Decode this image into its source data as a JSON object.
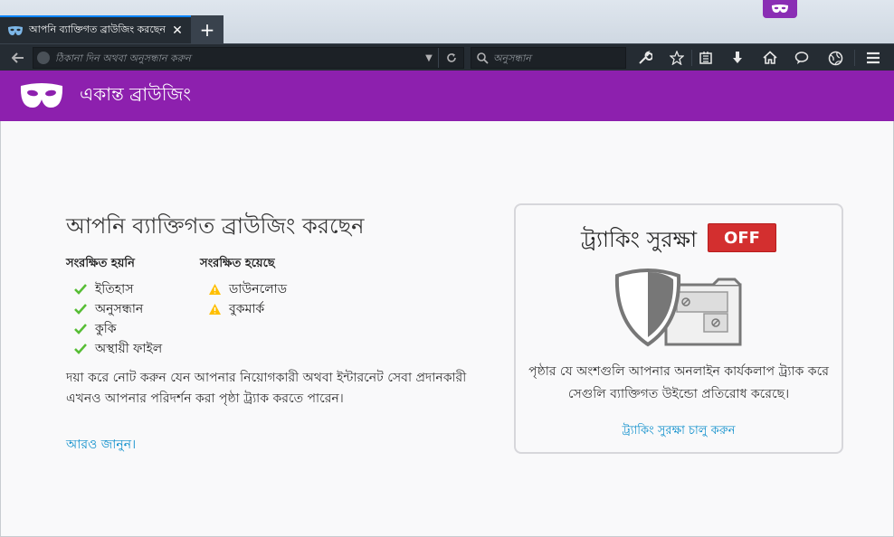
{
  "window": {
    "tab_title": "আপনি ব্যাক্তিগত ব্রাউজিং করছেন",
    "new_tab_label": "+"
  },
  "navbar": {
    "url_placeholder": "ঠিকানা দিন অথবা অনুসন্ধান করুন",
    "search_placeholder": "অনুসন্ধান"
  },
  "header": {
    "title": "একান্ত ব্রাউজিং"
  },
  "main": {
    "title": "আপনি ব্যাক্তিগত ব্রাউজিং করছেন",
    "not_saved": {
      "heading": "সংরক্ষিত হয়নি",
      "items": [
        "ইতিহাস",
        "অনুসন্ধান",
        "কুকি",
        "অস্থায়ী ফাইল"
      ]
    },
    "saved": {
      "heading": "সংরক্ষিত হয়েছে",
      "items": [
        "ডাউনলোড",
        "বুকমার্ক"
      ]
    },
    "note_line1": "দয়া করে নোট করুন যেন আপনার নিয়োগকারী অথবা ইন্টারনেট সেবা প্রদানকারী",
    "note_line2": "এখনও আপনার পরিদর্শন করা পৃষ্ঠা ট্র্যাক করতে পারেন।",
    "learn_more": "আরও জানুন।"
  },
  "tracking": {
    "title": "ট্র্যাকিং সুরক্ষা",
    "toggle_label": "OFF",
    "desc_line1": "পৃষ্ঠার যে অংশগুলি আপনার অনলাইন কার্যকলাপ ট্র্যাক করে",
    "desc_line2": "সেগুলি ব্যাক্তিগত উইন্ডো প্রতিরোধ করেছে।",
    "link": "ট্র্যাকিং সুরক্ষা চালু করুন"
  },
  "colors": {
    "accent_purple": "#8d20ae",
    "toggle_off": "#d32f2f",
    "link": "#0a8dcb",
    "check_green": "#57bd35",
    "warning_yellow": "#ffbf00"
  }
}
